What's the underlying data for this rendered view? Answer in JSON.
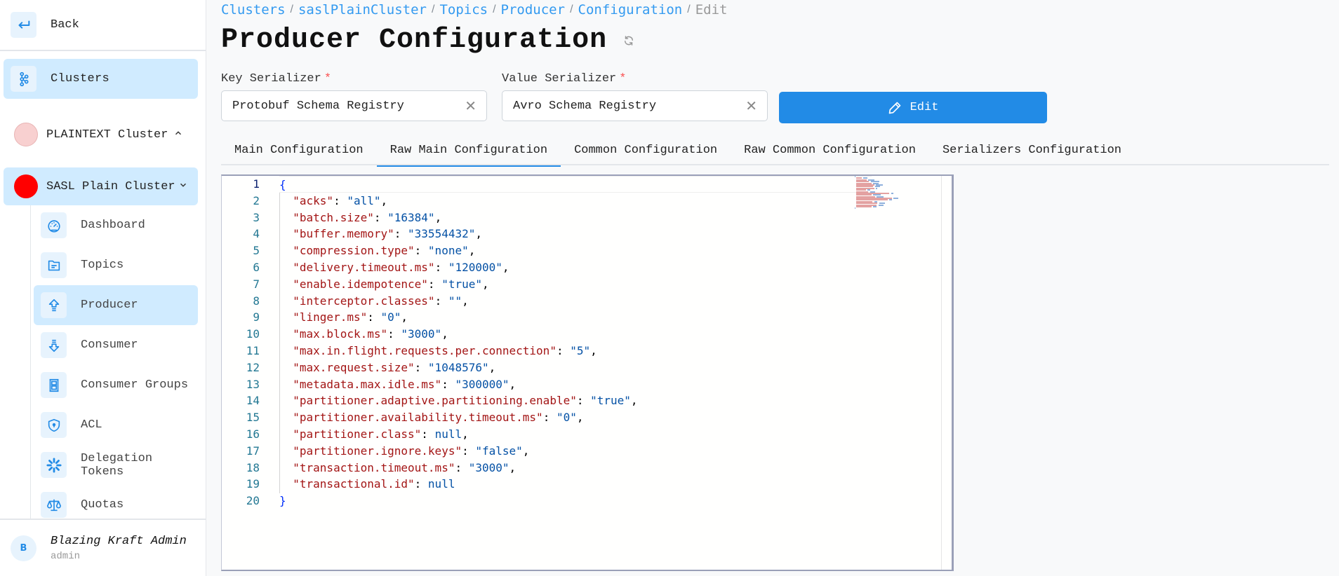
{
  "sidebar": {
    "back_label": "Back",
    "clusters_label": "Clusters",
    "clusters": [
      {
        "label": "PLAINTEXT Cluster",
        "color": "#f8d0d0",
        "expanded": false
      },
      {
        "label": "SASL Plain Cluster",
        "color": "#ff0000",
        "expanded": true
      }
    ],
    "items": [
      {
        "label": "Dashboard",
        "icon": "dashboard-gauge-icon",
        "active": false
      },
      {
        "label": "Topics",
        "icon": "folder-icon",
        "active": false
      },
      {
        "label": "Producer",
        "icon": "arrow-up-icon",
        "active": true
      },
      {
        "label": "Consumer",
        "icon": "arrow-down-icon",
        "active": false
      },
      {
        "label": "Consumer Groups",
        "icon": "groups-icon",
        "active": false
      },
      {
        "label": "ACL",
        "icon": "shield-icon",
        "active": false
      },
      {
        "label": "Delegation Tokens",
        "icon": "asterisk-icon",
        "active": false
      },
      {
        "label": "Quotas",
        "icon": "scale-icon",
        "active": false
      }
    ],
    "user": {
      "initial": "B",
      "name": "Blazing Kraft Admin",
      "role": "admin"
    }
  },
  "breadcrumb": {
    "items": [
      "Clusters",
      "saslPlainCluster",
      "Topics",
      "Producer",
      "Configuration"
    ],
    "current": "Edit",
    "separator": "/"
  },
  "page": {
    "title": "Producer Configuration"
  },
  "form": {
    "key_serializer": {
      "label": "Key Serializer",
      "required_mark": "*",
      "value": "Protobuf Schema Registry",
      "clear_glyph": "✕"
    },
    "value_serializer": {
      "label": "Value Serializer",
      "required_mark": "*",
      "value": "Avro Schema Registry",
      "clear_glyph": "✕"
    },
    "edit_label": "Edit"
  },
  "tabs": [
    {
      "label": "Main Configuration",
      "active": false
    },
    {
      "label": "Raw Main Configuration",
      "active": true
    },
    {
      "label": "Common Configuration",
      "active": false
    },
    {
      "label": "Raw Common Configuration",
      "active": false
    },
    {
      "label": "Serializers Configuration",
      "active": false
    }
  ],
  "editor": {
    "current_line": 1,
    "entries": [
      {
        "key": "acks",
        "value": "all",
        "type": "string"
      },
      {
        "key": "batch.size",
        "value": "16384",
        "type": "string"
      },
      {
        "key": "buffer.memory",
        "value": "33554432",
        "type": "string"
      },
      {
        "key": "compression.type",
        "value": "none",
        "type": "string"
      },
      {
        "key": "delivery.timeout.ms",
        "value": "120000",
        "type": "string"
      },
      {
        "key": "enable.idempotence",
        "value": "true",
        "type": "string"
      },
      {
        "key": "interceptor.classes",
        "value": "",
        "type": "string"
      },
      {
        "key": "linger.ms",
        "value": "0",
        "type": "string"
      },
      {
        "key": "max.block.ms",
        "value": "3000",
        "type": "string"
      },
      {
        "key": "max.in.flight.requests.per.connection",
        "value": "5",
        "type": "string"
      },
      {
        "key": "max.request.size",
        "value": "1048576",
        "type": "string"
      },
      {
        "key": "metadata.max.idle.ms",
        "value": "300000",
        "type": "string"
      },
      {
        "key": "partitioner.adaptive.partitioning.enable",
        "value": "true",
        "type": "string"
      },
      {
        "key": "partitioner.availability.timeout.ms",
        "value": "0",
        "type": "string"
      },
      {
        "key": "partitioner.class",
        "value": null,
        "type": "null"
      },
      {
        "key": "partitioner.ignore.keys",
        "value": "false",
        "type": "string"
      },
      {
        "key": "transaction.timeout.ms",
        "value": "3000",
        "type": "string"
      },
      {
        "key": "transactional.id",
        "value": null,
        "type": "null"
      }
    ]
  },
  "colors": {
    "accent": "#228be6",
    "active_bg": "#d0ebff",
    "json_key": "#a31515",
    "json_value": "#0451a5"
  }
}
